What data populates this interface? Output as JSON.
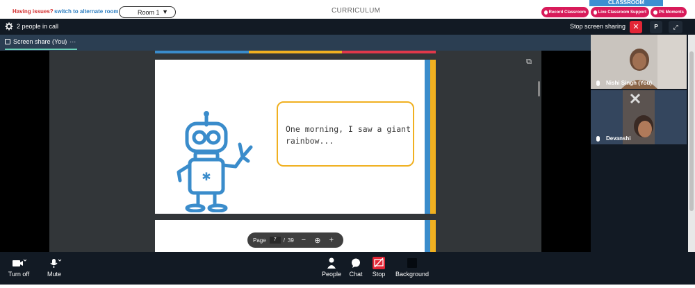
{
  "topbar": {
    "issues_label": "Having issues?",
    "switch_label": "switch to alternate room",
    "room_value": "Room 1",
    "curriculum_label": "CURRICULUM",
    "classroom_label": "CLASSROOM",
    "record_label": "Record Classroom",
    "support_label": "Live Classroom Support",
    "moments_label": "PS Moments"
  },
  "callbar": {
    "people_count": "2 people in call",
    "stop_sharing_label": "Stop screen sharing",
    "close_glyph": "✕",
    "p_label": "P",
    "expand_glyph": "⤢"
  },
  "share": {
    "tab_label": "Screen share (You)",
    "more_glyph": "···"
  },
  "slide": {
    "bubble_text": "One morning, I saw a giant rainbow..."
  },
  "pager": {
    "page_label": "Page",
    "current_page": "7",
    "separator": "/",
    "total_pages": "39",
    "zoom_out_glyph": "−",
    "zoom_glyph": "⊕",
    "zoom_in_glyph": "+"
  },
  "participants": [
    {
      "name": "Nishi Singh (You)"
    },
    {
      "name": "Devanshi"
    }
  ],
  "controls": {
    "camera_label": "Turn off",
    "mic_label": "Mute",
    "people_label": "People",
    "chat_label": "Chat",
    "stop_label": "Stop",
    "background_label": "Background"
  },
  "colors": {
    "brand_pink": "#d81b5a",
    "stop_red": "#e32636",
    "slide_blue": "#3a8ccb",
    "slide_yellow": "#f0b020",
    "slide_red": "#e0384a"
  }
}
